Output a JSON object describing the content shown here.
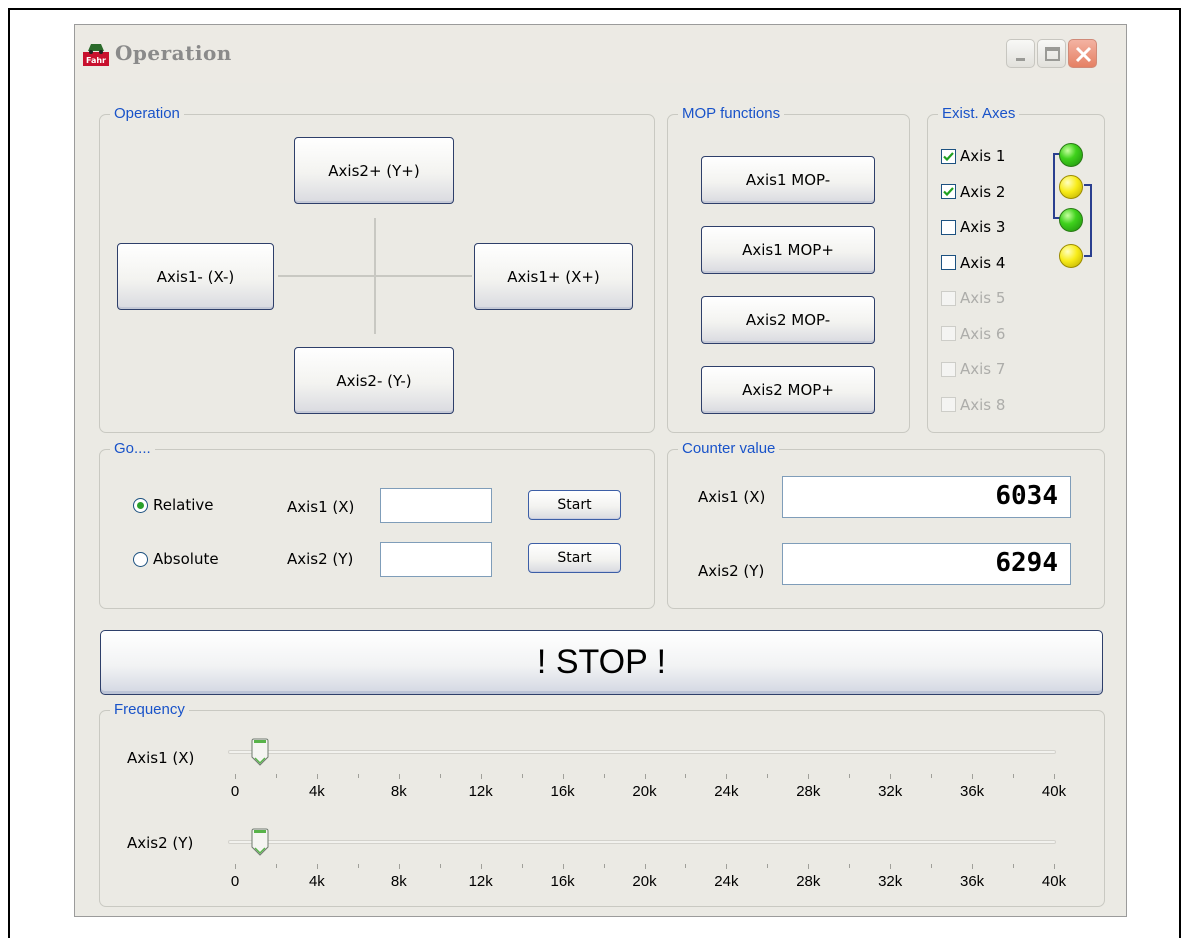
{
  "window": {
    "title": "Operation",
    "icon_text": "Fahr"
  },
  "operation": {
    "group_title": "Operation",
    "axis2_plus": "Axis2+ (Y+)",
    "axis1_minus": "Axis1- (X-)",
    "axis1_plus": "Axis1+ (X+)",
    "axis2_minus": "Axis2- (Y-)"
  },
  "mop": {
    "group_title": "MOP functions",
    "buttons": [
      "Axis1 MOP-",
      "Axis1 MOP+",
      "Axis2 MOP-",
      "Axis2 MOP+"
    ]
  },
  "axes": {
    "group_title": "Exist. Axes",
    "items": [
      {
        "label": "Axis 1",
        "checked": true,
        "enabled": true
      },
      {
        "label": "Axis 2",
        "checked": true,
        "enabled": true
      },
      {
        "label": "Axis 3",
        "checked": false,
        "enabled": true
      },
      {
        "label": "Axis 4",
        "checked": false,
        "enabled": true
      },
      {
        "label": "Axis 5",
        "checked": false,
        "enabled": false
      },
      {
        "label": "Axis 6",
        "checked": false,
        "enabled": false
      },
      {
        "label": "Axis 7",
        "checked": false,
        "enabled": false
      },
      {
        "label": "Axis 8",
        "checked": false,
        "enabled": false
      }
    ],
    "leds": [
      "green",
      "yellow",
      "green",
      "yellow"
    ]
  },
  "go": {
    "group_title": "Go....",
    "relative": "Relative",
    "absolute": "Absolute",
    "mode_selected": "Relative",
    "axis1_label": "Axis1 (X)",
    "axis2_label": "Axis2 (Y)",
    "axis1_value": "",
    "axis2_value": "",
    "start": "Start"
  },
  "counter": {
    "group_title": "Counter value",
    "axis1_label": "Axis1 (X)",
    "axis2_label": "Axis2 (Y)",
    "axis1_value": "6034",
    "axis2_value": "6294"
  },
  "stop": {
    "label": "! STOP !"
  },
  "frequency": {
    "group_title": "Frequency",
    "axis1_label": "Axis1 (X)",
    "axis2_label": "Axis2 (Y)",
    "tick_labels": [
      "0",
      "4k",
      "8k",
      "12k",
      "16k",
      "20k",
      "24k",
      "28k",
      "32k",
      "36k",
      "40k"
    ],
    "axis1_value_fraction": 0.03,
    "axis2_value_fraction": 0.03
  },
  "colors": {
    "group_title": "#1953c9",
    "window_bg": "#ebeae4",
    "led_green": "#3fd21c",
    "led_yellow": "#f8ec19"
  }
}
